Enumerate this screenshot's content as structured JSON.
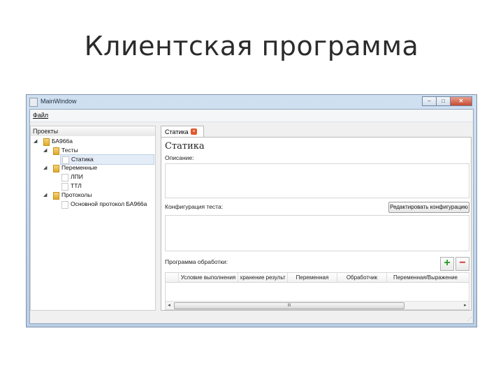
{
  "slide": {
    "title": "Клиентская программа"
  },
  "window": {
    "title": "MainWindow",
    "controls": {
      "minimize": "–",
      "maximize": "□",
      "close": "✕"
    }
  },
  "menubar": {
    "items": [
      {
        "label": "Файл"
      }
    ]
  },
  "projects_panel": {
    "header": "Проекты",
    "tree": [
      {
        "label": "БА966а",
        "kind": "folder",
        "level": 0,
        "expanded": true
      },
      {
        "label": "Тесты",
        "kind": "folder",
        "level": 1,
        "expanded": true
      },
      {
        "label": "Статика",
        "kind": "file",
        "level": 2,
        "selected": true
      },
      {
        "label": "Переменные",
        "kind": "folder",
        "level": 1,
        "expanded": true
      },
      {
        "label": "ЛПИ",
        "kind": "file",
        "level": 2
      },
      {
        "label": "ТТЛ",
        "kind": "file",
        "level": 2
      },
      {
        "label": "Протоколы",
        "kind": "folder",
        "level": 1,
        "expanded": true
      },
      {
        "label": "Основной протокол БА966а",
        "kind": "file",
        "level": 2
      }
    ]
  },
  "editor": {
    "tab": {
      "label": "Статика",
      "close": "×"
    },
    "heading": "Статика",
    "description_label": "Описание:",
    "config_label": "Конфигурация теста:",
    "edit_config_button": "Редактировать конфигурацию",
    "processing_label": "Программа обработки:",
    "add_button": "+",
    "remove_button": "−",
    "table": {
      "columns": [
        "Условие выполнения",
        "хранение результ",
        "Переменная",
        "Обработчик",
        "Переменная/Выражение"
      ]
    },
    "scrollbar": {
      "left": "◂",
      "right": "▸",
      "thumb": "III"
    }
  },
  "statusbar": {
    "grip": "⋰"
  },
  "colors": {
    "titlebar": "#c4d7ec",
    "tab_close": "#e0572e",
    "add": "#1f9d1f",
    "remove": "#d22a2a",
    "folder": "#e7b23a"
  },
  "icons": [
    "app-icon",
    "folder-icon",
    "file-icon",
    "expand-arrow-icon",
    "close-icon"
  ]
}
